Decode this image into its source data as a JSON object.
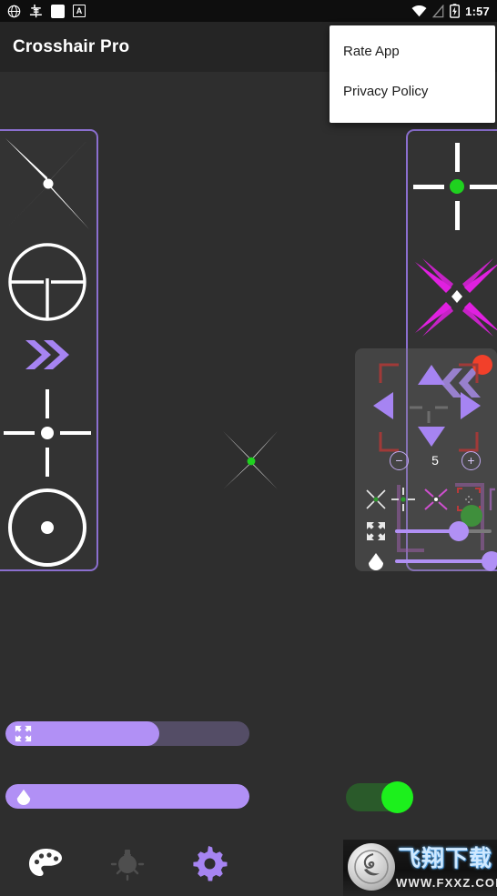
{
  "statusbar": {
    "icons": [
      "globe-bug-icon",
      "bug-icon",
      "white-square-icon",
      "a-badge-icon"
    ],
    "wifi_icon": "wifi-icon",
    "signal_icon": "no-signal-icon",
    "battery_icon": "battery-charging-icon",
    "time": "1:57"
  },
  "appbar": {
    "title": "Crosshair Pro"
  },
  "menu": {
    "items": [
      {
        "label": "Rate App"
      },
      {
        "label": "Privacy Policy"
      }
    ]
  },
  "left_panel": {
    "name": "crosshair-style-list-left",
    "border_color": "#8b6fcf",
    "items": [
      {
        "style": "x-spike",
        "color": "#ffffff",
        "dot_color": "#ffffff"
      },
      {
        "style": "scope-circle",
        "color": "#ffffff"
      },
      {
        "style": "double-chevron",
        "color": "#a684f2"
      },
      {
        "style": "plus-gap-dot",
        "color": "#ffffff"
      },
      {
        "style": "arc-ring-dot",
        "color": "#ffffff"
      }
    ]
  },
  "right_panel": {
    "name": "crosshair-style-list-right",
    "border_color": "#8b6fcf",
    "items": [
      {
        "style": "plus-gap-dot",
        "color": "#ffffff",
        "dot_color": "#1fd11f"
      },
      {
        "style": "x-blade-diamond",
        "color": "#e020e0",
        "center_color": "#ffffff"
      },
      {
        "style": "double-chevron-left",
        "color": "#a684f2"
      }
    ]
  },
  "main_crosshair": {
    "style": "x-spike",
    "color": "#ffffff",
    "dot_color": "#1fd11f"
  },
  "overlay": {
    "name": "floating-settings-overlay",
    "record_dot_color": "#f2402a",
    "dpad": {
      "up": "arrow-up-button",
      "down": "arrow-down-button",
      "left": "arrow-left-button",
      "right": "arrow-right-button",
      "color": "#a684f2"
    },
    "stepper": {
      "minus": "−",
      "value": "5",
      "plus": "+"
    },
    "rows": [
      {
        "icon": "crosshair-icon",
        "type": "thumbnails"
      },
      {
        "icon": "resize-icon",
        "type": "slider",
        "fill_pct": 62
      },
      {
        "icon": "opacity-drop-icon",
        "type": "slider",
        "fill_pct": 95
      }
    ],
    "green_indicator_color": "#3f8f3c"
  },
  "bottom_controls": {
    "size_slider": {
      "icon": "resize-icon",
      "fill_pct": 63,
      "fill_color": "#b190f5",
      "track_color": "#544d66"
    },
    "opacity_slider": {
      "icon": "opacity-drop-icon",
      "fill_pct": 100,
      "fill_color": "#b190f5",
      "track_color": "#544d66"
    },
    "toggle": {
      "state": "on",
      "on_color": "#1cf01c",
      "track_color": "#2a5a2a"
    },
    "icons": [
      {
        "name": "palette-icon",
        "color": "#ffffff"
      },
      {
        "name": "brightness-bulb-icon",
        "color": "#4a4a4a"
      },
      {
        "name": "settings-gear-icon",
        "color": "#a684f2"
      }
    ]
  },
  "watermark": {
    "brand_cn": "飞翔下载",
    "url": "WWW.FXXZ.COM"
  }
}
